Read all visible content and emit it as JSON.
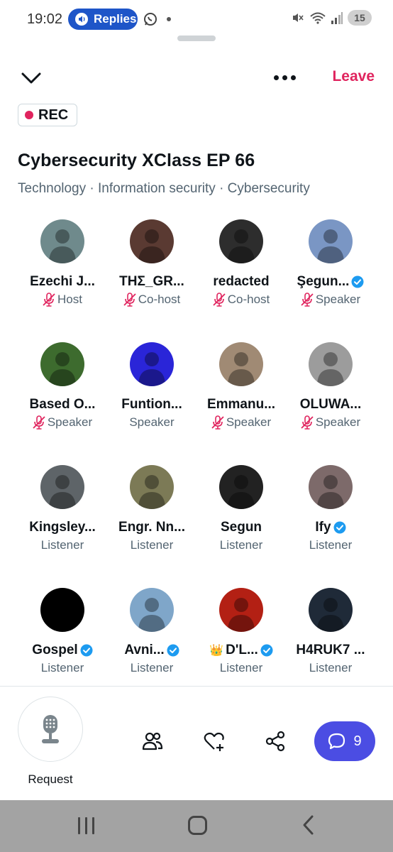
{
  "status_bar": {
    "time": "19:02",
    "pill_label": "Replies",
    "battery": "15",
    "icons": [
      "speaker-icon",
      "whatsapp-icon",
      "mute-icon",
      "wifi-icon",
      "signal-icon"
    ]
  },
  "header": {
    "leave_label": "Leave",
    "rec_label": "REC"
  },
  "space": {
    "title": "Cybersecurity XClass EP 66",
    "topics": "Technology · Information security · Cybersecurity"
  },
  "colors": {
    "accent_red": "#e0245e",
    "verified_blue": "#1d9bf0",
    "comments_purple": "#4b4de3",
    "pill_blue": "#1e55c8"
  },
  "participants": [
    {
      "name": "Ezechi J...",
      "role": "Host",
      "muted": true,
      "verified": false,
      "avatar_bg": "#6f8a8c"
    },
    {
      "name": "THΣ_GR...",
      "role": "Co-host",
      "muted": true,
      "verified": false,
      "avatar_bg": "#5a3a32"
    },
    {
      "name": "redacted",
      "role": "Co-host",
      "muted": true,
      "verified": false,
      "avatar_bg": "#2d2d2d"
    },
    {
      "name": "Şegun...",
      "role": "Speaker",
      "muted": true,
      "verified": true,
      "avatar_bg": "#7a96c4"
    },
    {
      "name": "Based O...",
      "role": "Speaker",
      "muted": true,
      "verified": false,
      "avatar_bg": "#3d6b2e"
    },
    {
      "name": "Funtion...",
      "role": "Speaker",
      "muted": false,
      "verified": false,
      "avatar_bg": "#2a25d8"
    },
    {
      "name": "Emmanu...",
      "role": "Speaker",
      "muted": true,
      "verified": false,
      "avatar_bg": "#a08a74"
    },
    {
      "name": "OLUWA...",
      "role": "Speaker",
      "muted": true,
      "verified": false,
      "avatar_bg": "#9c9c9c"
    },
    {
      "name": "Kingsley...",
      "role": "Listener",
      "muted": false,
      "verified": false,
      "avatar_bg": "#5e6468"
    },
    {
      "name": "Engr. Nn...",
      "role": "Listener",
      "muted": false,
      "verified": false,
      "avatar_bg": "#7c7a56"
    },
    {
      "name": "Segun",
      "role": "Listener",
      "muted": false,
      "verified": false,
      "avatar_bg": "#222222"
    },
    {
      "name": "Ify",
      "role": "Listener",
      "muted": false,
      "verified": true,
      "avatar_bg": "#7d6a6a"
    },
    {
      "name": "Gospel",
      "role": "Listener",
      "muted": false,
      "verified": true,
      "avatar_bg": "#000000"
    },
    {
      "name": "Avni...",
      "role": "Listener",
      "muted": false,
      "verified": true,
      "avatar_bg": "#7fa6c9"
    },
    {
      "name": "D'L...",
      "role": "Listener",
      "muted": false,
      "verified": true,
      "crown": true,
      "avatar_bg": "#b32014"
    },
    {
      "name": "H4RUK7 ...",
      "role": "Listener",
      "muted": false,
      "verified": false,
      "avatar_bg": "#1f2a38"
    }
  ],
  "bottom_bar": {
    "request_label": "Request",
    "comments_count": "9"
  }
}
